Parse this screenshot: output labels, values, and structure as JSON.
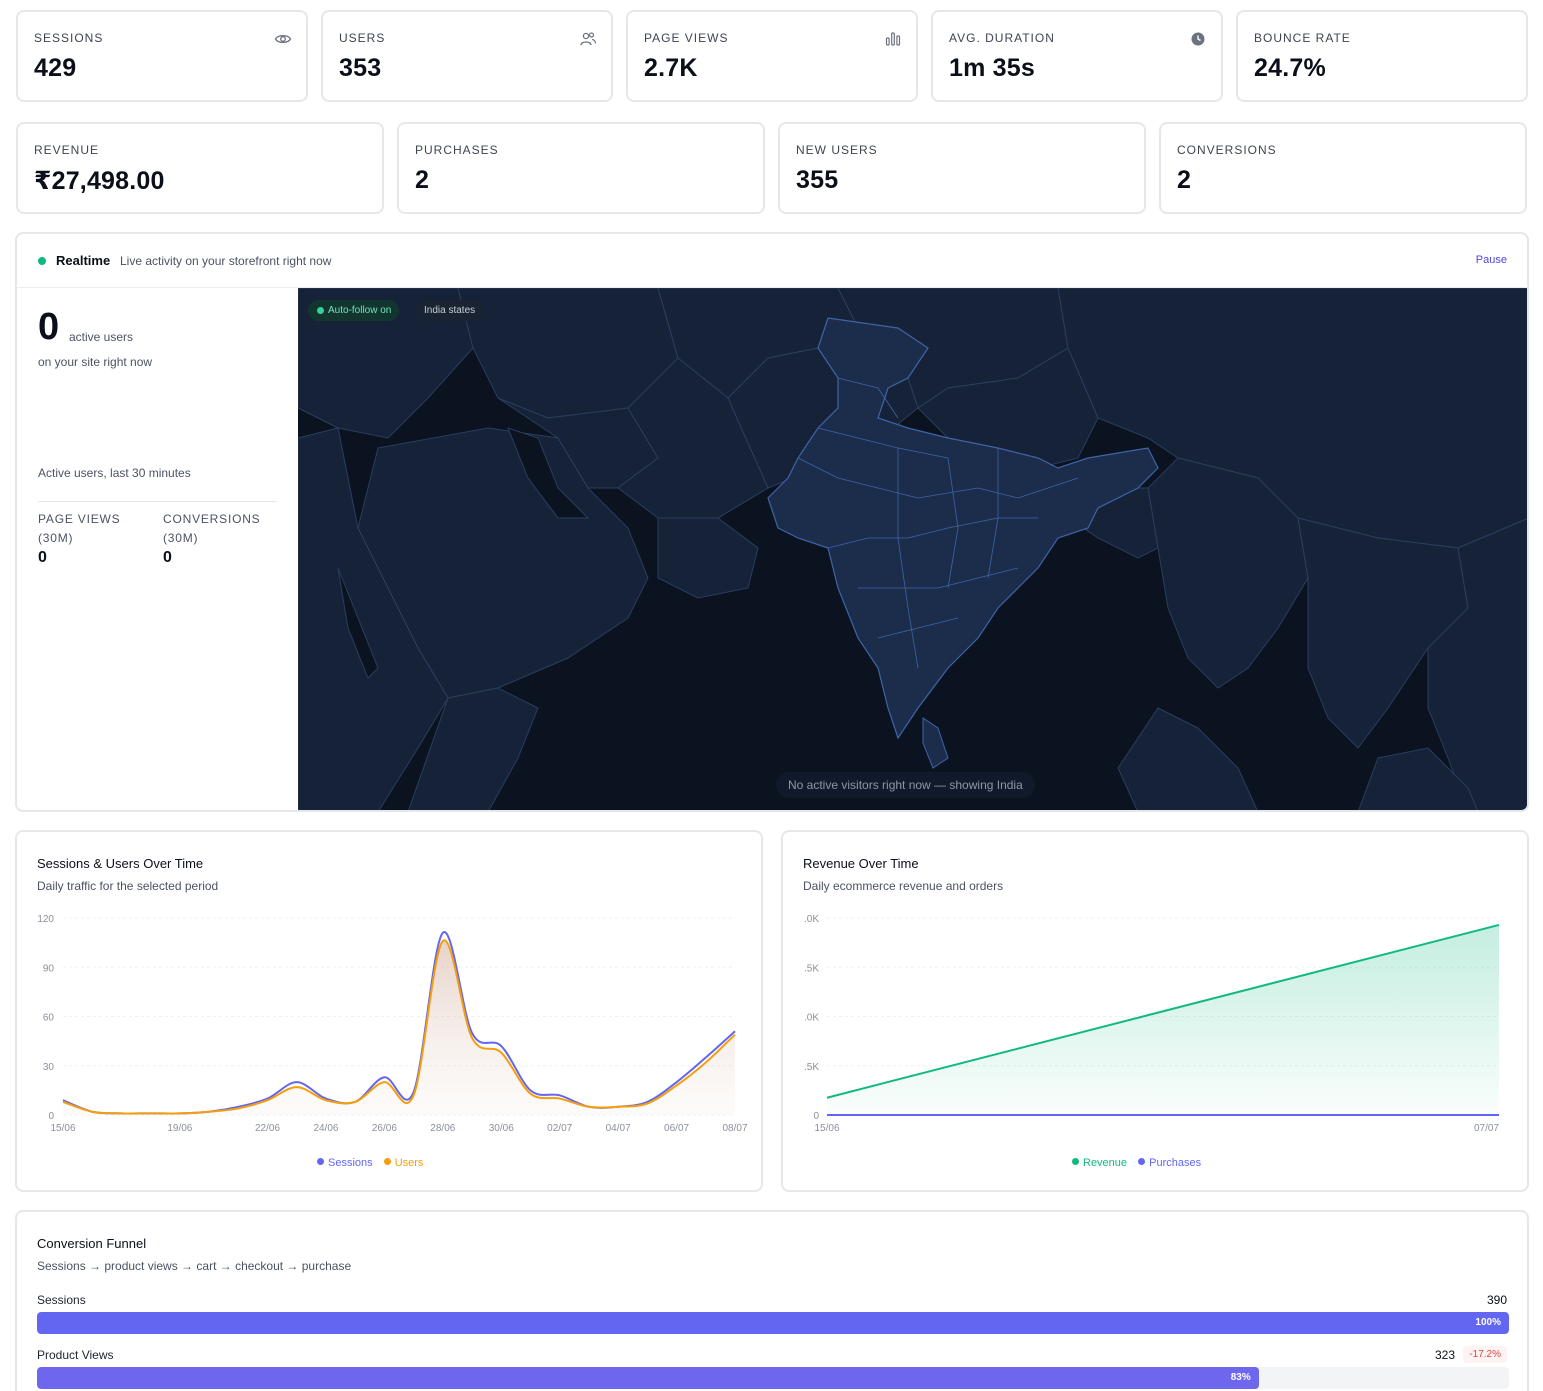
{
  "stats_row1": [
    {
      "label": "SESSIONS",
      "value": "429",
      "icon": "eye-icon"
    },
    {
      "label": "USERS",
      "value": "353",
      "icon": "users-icon"
    },
    {
      "label": "PAGE VIEWS",
      "value": "2.7K",
      "icon": "bar-chart-icon"
    },
    {
      "label": "AVG. DURATION",
      "value": "1m 35s",
      "icon": "clock-icon"
    },
    {
      "label": "BOUNCE RATE",
      "value": "24.7%",
      "icon": ""
    }
  ],
  "stats_row2": [
    {
      "label": "REVENUE",
      "value": "₹27,498.00"
    },
    {
      "label": "PURCHASES",
      "value": "2"
    },
    {
      "label": "NEW USERS",
      "value": "355"
    },
    {
      "label": "CONVERSIONS",
      "value": "2"
    }
  ],
  "realtime": {
    "title": "Realtime",
    "subtitle": "Live activity on your storefront right now",
    "pause_label": "Pause",
    "active_count": "0",
    "active_label": "active users",
    "active_sub": "on your site right now",
    "last30_label": "Active users, last 30 minutes",
    "page_views_label": "PAGE VIEWS (30M)",
    "page_views_value": "0",
    "conversions_label": "CONVERSIONS (30M)",
    "conversions_value": "0",
    "map": {
      "autofollow_label": "Auto-follow on",
      "region_label": "India states",
      "empty_message": "No active visitors right now — showing India"
    }
  },
  "sessions_chart": {
    "title": "Sessions & Users Over Time",
    "subtitle": "Daily traffic for the selected period",
    "legend": [
      "Sessions",
      "Users"
    ]
  },
  "revenue_chart": {
    "title": "Revenue Over Time",
    "subtitle": "Daily ecommerce revenue and orders",
    "legend": [
      "Revenue",
      "Purchases"
    ]
  },
  "chart_data": [
    {
      "type": "line",
      "title": "Sessions & Users Over Time",
      "x": [
        "15/06",
        "16/06",
        "17/06",
        "18/06",
        "19/06",
        "20/06",
        "21/06",
        "22/06",
        "23/06",
        "24/06",
        "25/06",
        "26/06",
        "27/06",
        "28/06",
        "29/06",
        "30/06",
        "01/07",
        "02/07",
        "03/07",
        "04/07",
        "05/07",
        "06/07",
        "07/07",
        "08/07"
      ],
      "x_tick_labels": [
        "15/06",
        "19/06",
        "22/06",
        "24/06",
        "26/06",
        "28/06",
        "30/06",
        "02/07",
        "04/07",
        "06/07",
        "08/07"
      ],
      "y_ticks": [
        "0",
        "30",
        "60",
        "90",
        "120"
      ],
      "ylim": [
        0,
        120
      ],
      "series": [
        {
          "name": "Sessions",
          "color": "#6366f1",
          "values": [
            9,
            2,
            1,
            1,
            1,
            2,
            5,
            10,
            20,
            10,
            8,
            23,
            14,
            111,
            50,
            42,
            15,
            12,
            5,
            5,
            8,
            20,
            35,
            51
          ]
        },
        {
          "name": "Users",
          "color": "#f59e0b",
          "values": [
            8,
            2,
            1,
            1,
            1,
            2,
            4,
            9,
            17,
            9,
            8,
            20,
            12,
            106,
            47,
            38,
            13,
            10,
            5,
            5,
            7,
            18,
            32,
            49
          ]
        }
      ]
    },
    {
      "type": "area",
      "title": "Revenue Over Time",
      "x": [
        "15/06",
        "07/07"
      ],
      "x_tick_labels": [
        "15/06",
        "07/07"
      ],
      "y_ticks": [
        ".0K",
        ".5K",
        ".0K",
        ".5K",
        "0"
      ],
      "series": [
        {
          "name": "Revenue",
          "color": "#10b981",
          "values": [
            2500,
            27498
          ]
        },
        {
          "name": "Purchases",
          "color": "#6366f1",
          "values": [
            0,
            0
          ]
        }
      ]
    }
  ],
  "funnel": {
    "title": "Conversion Funnel",
    "subtitle": "Sessions → product views → cart → checkout → purchase",
    "stages": [
      {
        "label": "Sessions",
        "count": "390",
        "percent": 100,
        "percent_label": "100%",
        "delta": "",
        "color": "#6366f1"
      },
      {
        "label": "Product Views",
        "count": "323",
        "percent": 83,
        "percent_label": "83%",
        "delta": "-17.2%",
        "color": "#6f66ee"
      }
    ]
  }
}
